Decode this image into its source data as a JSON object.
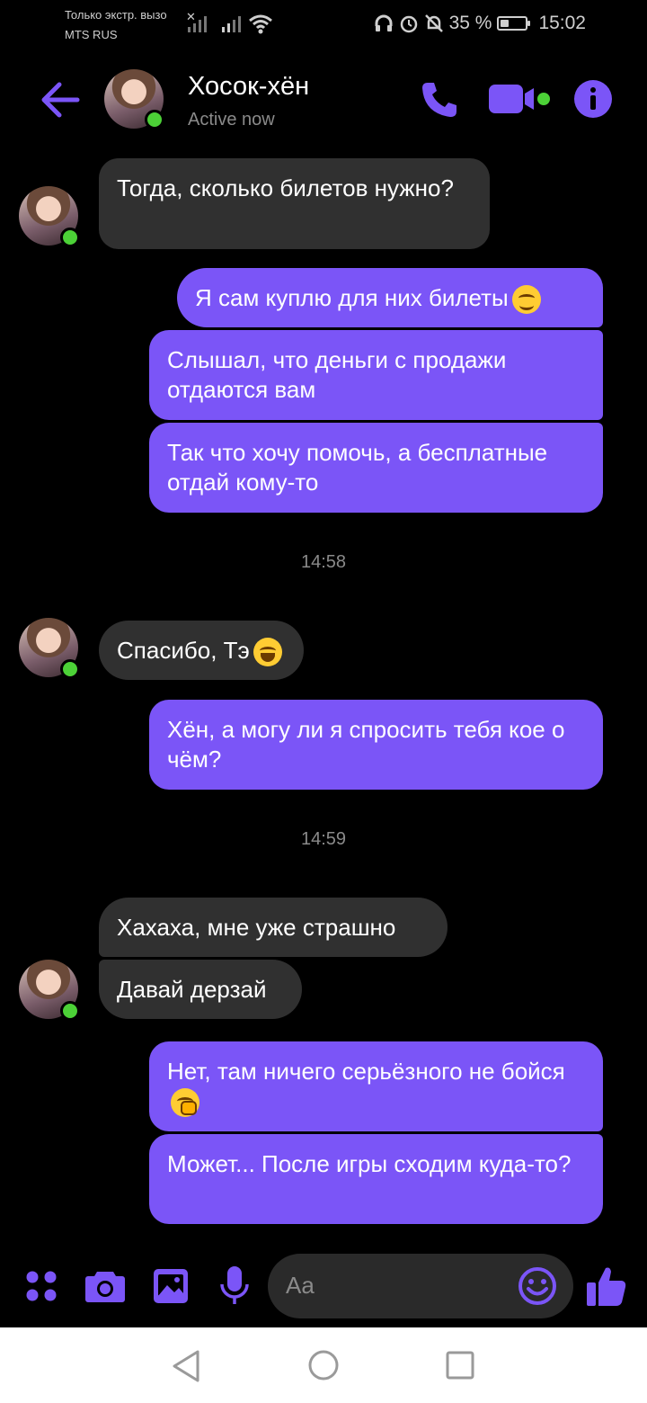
{
  "status_bar": {
    "carrier_line1": "Только экстр. вызо",
    "carrier_line2": "MTS RUS",
    "battery": "35 %",
    "battery_level": 0.35,
    "time": "15:02"
  },
  "header": {
    "contact_name": "Хосок-хён",
    "status": "Active now"
  },
  "messages": [
    {
      "side": "received",
      "text": "Тогда, сколько билетов нужно?"
    },
    {
      "side": "sent",
      "text": "Я сам куплю для них билеты",
      "emoji": "smiling-face-emoji"
    },
    {
      "side": "sent",
      "text": "Слышал, что деньги с продажи отдаются вам"
    },
    {
      "side": "sent",
      "text": "Так что хочу помочь, а бесплатные отдай кому-то"
    },
    {
      "side": "timestamp",
      "text": "14:58"
    },
    {
      "side": "received",
      "text": "Спасибо, Тэ",
      "emoji": "grinning-face-emoji"
    },
    {
      "side": "sent",
      "text": "Хён, а могу ли я спросить тебя кое о чём?"
    },
    {
      "side": "timestamp",
      "text": "14:59"
    },
    {
      "side": "received",
      "text": "Хахаха, мне уже страшно"
    },
    {
      "side": "received",
      "text": "Давай дерзай"
    },
    {
      "side": "sent",
      "text": "Нет, там ничего серьёзного не бойся",
      "emoji": "face-with-hand-over-mouth-emoji"
    },
    {
      "side": "sent",
      "text": "Может... После игры сходим куда-то?"
    }
  ],
  "composer": {
    "placeholder": "Aa"
  },
  "colors": {
    "accent": "#7b55f7",
    "sent_bubble": "#7b55f7",
    "received_bubble": "#303030",
    "online": "#4cd137",
    "background": "#000000"
  }
}
